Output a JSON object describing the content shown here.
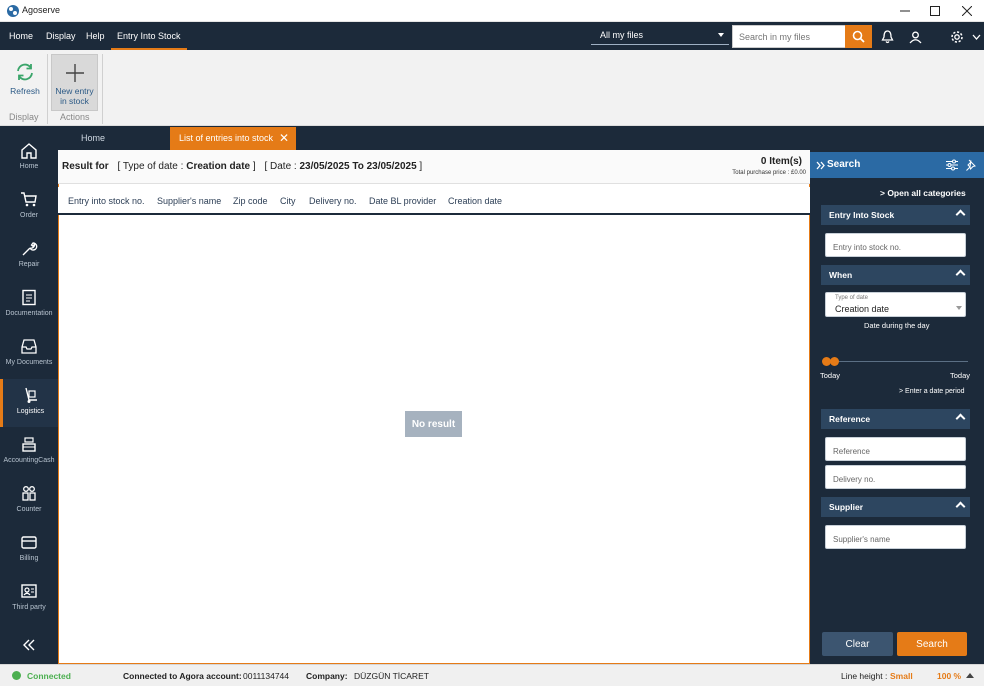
{
  "window": {
    "title": "Agoserve"
  },
  "menu": {
    "items": [
      "Home",
      "Display",
      "Help",
      "Entry Into Stock"
    ]
  },
  "files_select": {
    "value": "All my files"
  },
  "search": {
    "placeholder": "Search in my files"
  },
  "ribbon": {
    "refresh_label": "Refresh",
    "new_entry_label_1": "New entry",
    "new_entry_label_2": "in stock",
    "group_display": "Display",
    "group_actions": "Actions"
  },
  "tabs": {
    "home": "Home",
    "list": "List of entries into stock"
  },
  "nav": {
    "items": [
      "Home",
      "Order",
      "Repair",
      "Documentation",
      "My Documents",
      "Logistics",
      "AccountingCash",
      "Counter",
      "Billing",
      "Third party"
    ],
    "active": "Logistics"
  },
  "result": {
    "prefix": "Result for",
    "type_label": "[ Type of date :",
    "type_value": "Creation date",
    "type_close": "]",
    "date_label": "[ Date :",
    "date_value": "23/05/2025 To 23/05/2025",
    "date_close": "]",
    "count": "0 Item(s)",
    "total": "Total purchase price : £0.00"
  },
  "columns": [
    "Entry into stock no.",
    "Supplier's name",
    "Zip code",
    "City",
    "Delivery no.",
    "Date BL provider",
    "Creation date"
  ],
  "empty_state": "No result",
  "panel": {
    "title": "Search",
    "open_all": "> Open all categories",
    "sections": {
      "entry": "Entry Into Stock",
      "when": "When",
      "reference": "Reference",
      "supplier": "Supplier"
    },
    "entry_placeholder": "Entry into stock no.",
    "date_type_label": "Type of date",
    "date_type_value": "Creation date",
    "date_during": "Date during the day",
    "slider_left": "Today",
    "slider_right": "Today",
    "enter_period": "> Enter a date period",
    "reference_placeholder": "Reference",
    "delivery_placeholder": "Delivery no.",
    "supplier_placeholder": "Supplier's name",
    "clear_label": "Clear",
    "search_label": "Search"
  },
  "status": {
    "connected": "Connected",
    "account_label": "Connected to Agora account:",
    "account_value": "0011134744",
    "company_label": "Company:",
    "company_value": "DÜZGÜN TİCARET",
    "line_height_label": "Line height :",
    "line_height_value": "Small",
    "zoom": "100 %"
  },
  "colors": {
    "accent": "#e57b17",
    "navy": "#1c2a3a",
    "panel_head": "#2b6aa4",
    "connected": "#4caf50"
  }
}
